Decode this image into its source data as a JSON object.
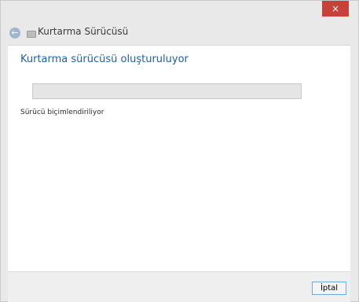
{
  "window": {
    "title": "Kurtarma Sürücüsü",
    "close_label": "×",
    "back_label": "←"
  },
  "main": {
    "heading": "Kurtarma sürücüsü oluşturuluyor",
    "progress": 0,
    "status": "Sürücü biçimlendiriliyor"
  },
  "footer": {
    "cancel_label": "İptal"
  },
  "colors": {
    "accent": "#1f5ea8",
    "close": "#c7403a",
    "background": "#e9e9e9"
  }
}
